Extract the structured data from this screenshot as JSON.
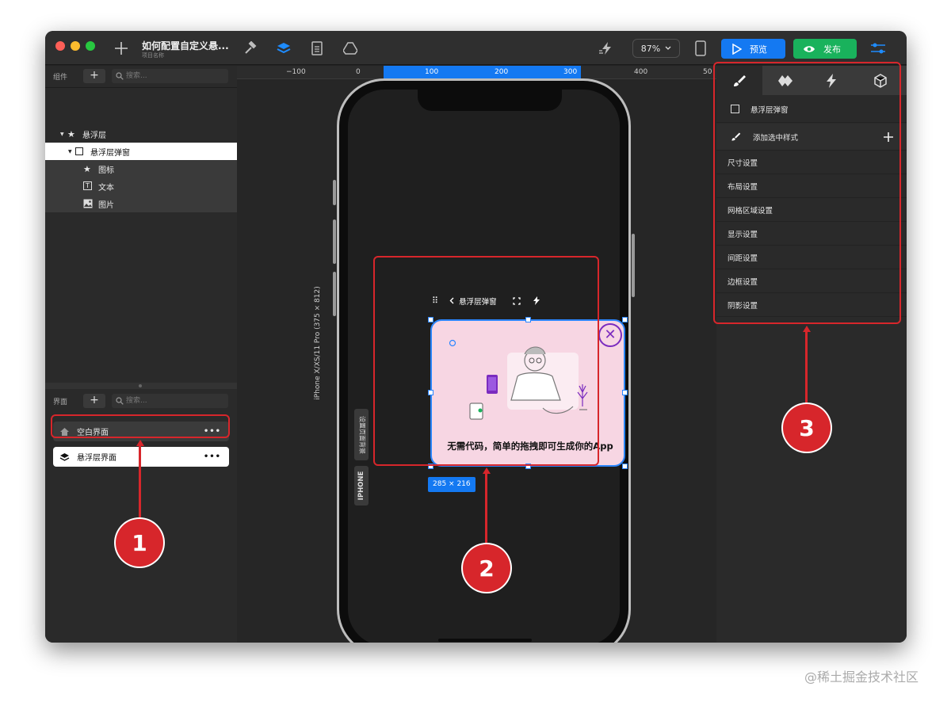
{
  "window": {
    "title": "如何配置自定义悬...",
    "subtitle": "项目名称",
    "zoom": "87%",
    "preview_label": "预览",
    "publish_label": "发布"
  },
  "components_panel": {
    "label": "组件",
    "search_placeholder": "搜索...",
    "tree": [
      {
        "label": "悬浮层",
        "icon": "star-icon"
      },
      {
        "label": "悬浮层弹窗",
        "icon": "checkbox-icon"
      },
      {
        "label": "图标",
        "icon": "star-icon"
      },
      {
        "label": "文本",
        "icon": "text-icon"
      },
      {
        "label": "图片",
        "icon": "image-icon"
      }
    ]
  },
  "screens_panel": {
    "label": "界面",
    "search_placeholder": "搜索...",
    "items": [
      {
        "label": "空白界面",
        "icon": "home-icon"
      },
      {
        "label": "悬浮层界面",
        "icon": "layers-icon"
      }
    ]
  },
  "canvas": {
    "ruler_ticks": [
      "−100",
      "0",
      "100",
      "200",
      "300",
      "400",
      "50"
    ],
    "device_label": "iPhone X/XS/11 Pro (375 × 812)",
    "side_tab_1": "设置页面背景",
    "side_tab_2": "IPHONE",
    "popup_toolbar_label": "悬浮层弹窗",
    "popup_text": "无需代码，简单的拖拽即可生成你的App",
    "size_badge": "285 × 216"
  },
  "props_panel": {
    "selected_label": "悬浮层弹窗",
    "add_style_label": "添加选中样式",
    "sections": [
      "尺寸设置",
      "布局设置",
      "网格区域设置",
      "显示设置",
      "间距设置",
      "边框设置",
      "阴影设置"
    ]
  },
  "callouts": [
    "1",
    "2",
    "3"
  ],
  "watermark": "@稀土掘金技术社区",
  "colors": {
    "accent_blue": "#1479f2",
    "publish_green": "#19b25c",
    "annotation_red": "#d7262b",
    "popup_pink": "#f7d6e3",
    "close_purple": "#7b2cbf"
  }
}
